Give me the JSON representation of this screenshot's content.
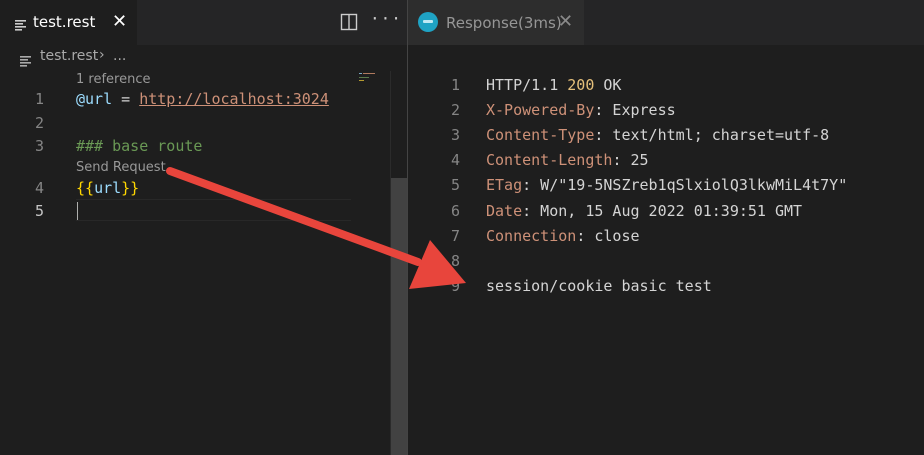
{
  "colors": {
    "accent_arrow": "#e8453c",
    "variable": "#9cdcfe",
    "url": "#ce9178",
    "comment": "#6a9955",
    "braces": "#ffd700",
    "header_key": "#ce9178",
    "status_code": "#e5c07b"
  },
  "left_editor": {
    "tab": {
      "label": "test.rest",
      "close": "✕",
      "icon": "lines-file-icon"
    },
    "actions": {
      "split": "split-editor-icon",
      "more": "···"
    },
    "breadcrumb": {
      "file": "test.rest",
      "separator": "›",
      "more": "..."
    },
    "codelens": {
      "references": "1 reference",
      "send_request": "Send Request"
    },
    "line_numbers": [
      "1",
      "2",
      "3",
      "4",
      "5"
    ],
    "lines": {
      "l1_var": "@url",
      "l1_eq": " = ",
      "l1_url": "http://localhost:3024",
      "l3_comment": "### base route",
      "l4_open": "{{",
      "l4_var": "url",
      "l4_close": "}}"
    }
  },
  "response_panel": {
    "tab": {
      "label": "Response(3ms)",
      "close": "✕",
      "icon": "rest-client-icon"
    },
    "line_numbers": [
      "1",
      "2",
      "3",
      "4",
      "5",
      "6",
      "7",
      "8",
      "9"
    ],
    "status_line": {
      "protocol": "HTTP/1.1 ",
      "code": "200",
      "text": " OK"
    },
    "headers": [
      {
        "key": "X-Powered-By",
        "value": ": Express"
      },
      {
        "key": "Content-Type",
        "value": ": text/html; charset=utf-8"
      },
      {
        "key": "Content-Length",
        "value": ": 25"
      },
      {
        "key": "ETag",
        "value": ": W/\"19-5NSZreb1qSlxiolQ3lkwMiL4t7Y\""
      },
      {
        "key": "Date",
        "value": ": Mon, 15 Aug 2022 01:39:51 GMT"
      },
      {
        "key": "Connection",
        "value": ": close"
      }
    ],
    "body": "session/cookie basic test"
  }
}
